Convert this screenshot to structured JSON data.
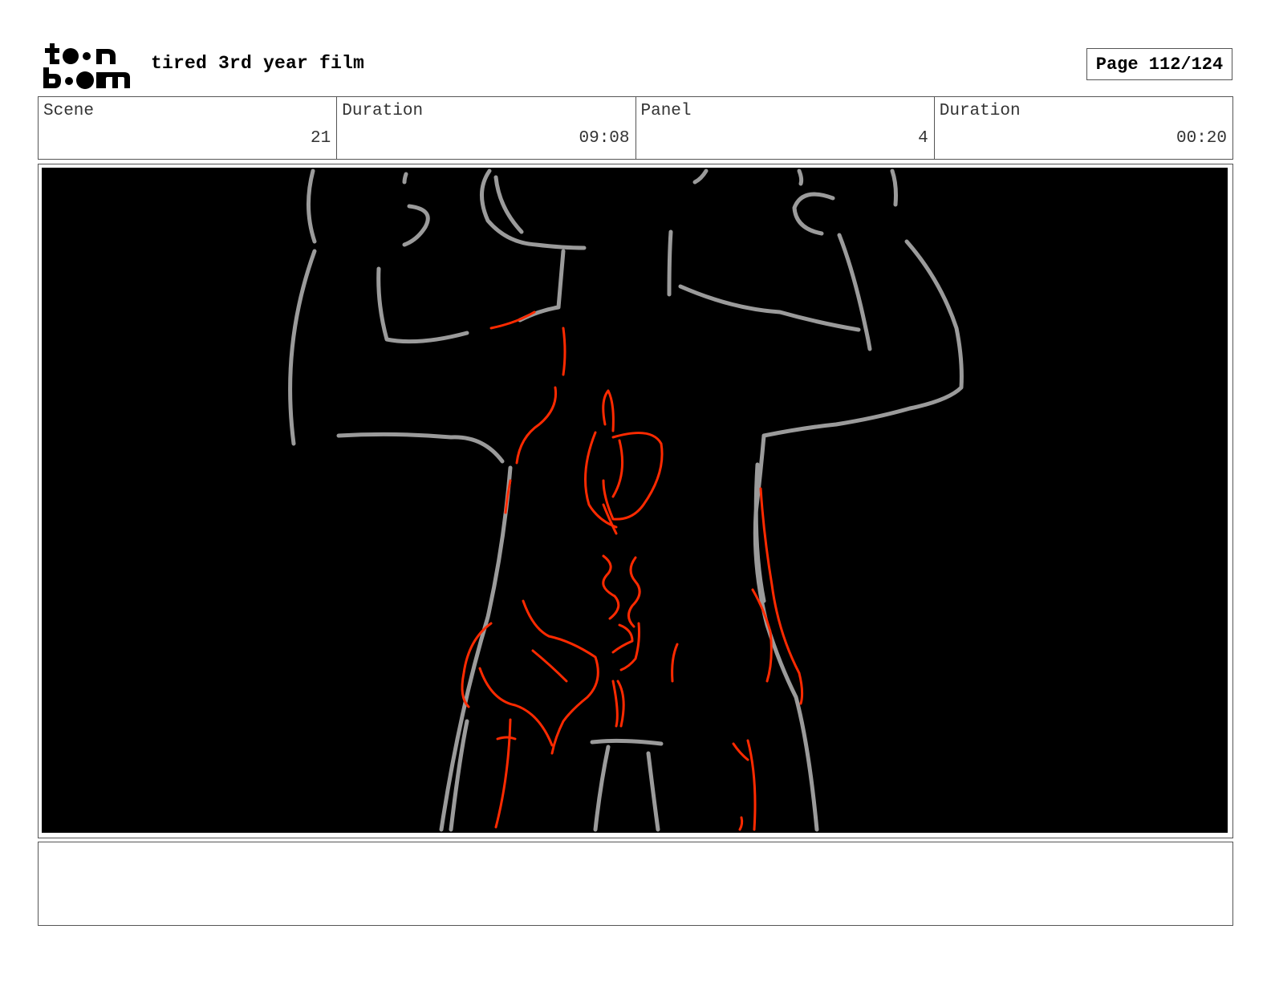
{
  "header": {
    "logo_text": "toon boom",
    "project_title": "tired 3rd year film",
    "page_label": "Page 112/124"
  },
  "info": {
    "scene_label": "Scene",
    "scene_value": "21",
    "scene_duration_label": "Duration",
    "scene_duration_value": "09:08",
    "panel_label": "Panel",
    "panel_value": "4",
    "panel_duration_label": "Duration",
    "panel_duration_value": "00:20"
  },
  "panel": {
    "background_color": "#000000",
    "sketch_gray": "#9b9b9b",
    "sketch_red": "#ff2a00"
  },
  "notes": {
    "text": ""
  }
}
